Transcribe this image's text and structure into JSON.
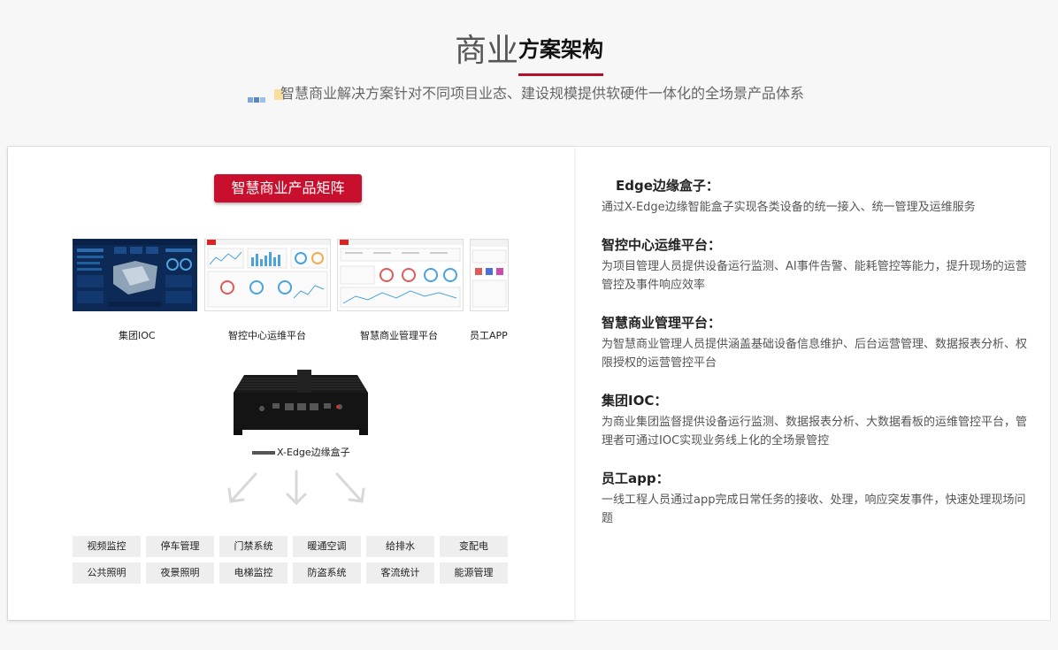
{
  "header": {
    "title_light": "商业",
    "title_bold": "方案架构",
    "subtitle": "智慧商业解决方案针对不同项目业态、建设规模提供软硬件一体化的全场景产品体系"
  },
  "matrix": {
    "badge": "智慧商业产品矩阵",
    "screens": [
      {
        "label": "集团IOC"
      },
      {
        "label": "智控中心运维平台"
      },
      {
        "label": "智慧商业管理平台"
      },
      {
        "label": "员工APP"
      }
    ],
    "device_label": "X-Edge边缘盒子",
    "systems": [
      "视频监控",
      "停车管理",
      "门禁系统",
      "暖通空调",
      "给排水",
      "变配电",
      "公共照明",
      "夜景照明",
      "电梯监控",
      "防盗系统",
      "客流统计",
      "能源管理"
    ]
  },
  "features": [
    {
      "title": "Edge边缘盒子：",
      "desc": "通过X-Edge边缘智能盒子实现各类设备的统一接入、统一管理及运维服务"
    },
    {
      "title": "智控中心运维平台：",
      "desc": "为项目管理人员提供设备运行监测、AI事件告警、能耗管控等能力，提升现场的运营管控及事件响应效率"
    },
    {
      "title": "智慧商业管理平台：",
      "desc": "为智慧商业管理人员提供涵盖基础设备信息维护、后台运营管理、数据报表分析、权限授权的运营管控平台"
    },
    {
      "title": "集团IOC：",
      "desc": "为商业集团监督提供设备运行监测、数据报表分析、大数据看板的运维管控平台，管理者可通过IOC实现业务线上化的全场景管控"
    },
    {
      "title": "员工app：",
      "desc": "一线工程人员通过app完成日常任务的接收、处理，响应突发事件，快速处理现场问题"
    }
  ],
  "colors": {
    "accent": "#c8102e",
    "underline": "#b3102a",
    "dashboard_dark": "#0c2a55"
  }
}
